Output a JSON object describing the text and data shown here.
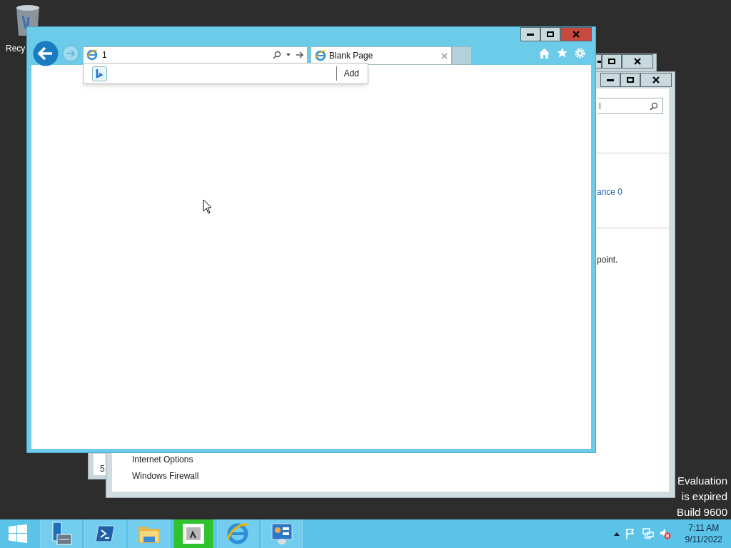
{
  "desktop": {
    "icons": [
      {
        "label": "Recy"
      }
    ],
    "watermark": [
      "Evaluation",
      "is expired",
      "Build 9600"
    ]
  },
  "back_window_1": {
    "fragment": "5"
  },
  "back_window_2": {
    "search_value": "l",
    "link": "ance 0",
    "text": "point.",
    "items": [
      "Internet Options",
      "Windows Firewall"
    ]
  },
  "browser": {
    "address": "1",
    "tabs": [
      {
        "title": "Blank Page",
        "selected": true
      }
    ],
    "suggestion_button": "Add"
  },
  "taskbar": {
    "apps": [
      {
        "kind": "start",
        "active": false
      },
      {
        "kind": "server",
        "active": false
      },
      {
        "kind": "shell",
        "active": false
      },
      {
        "kind": "folder",
        "active": false
      },
      {
        "kind": "app",
        "active": true
      },
      {
        "kind": "browser",
        "active": false
      },
      {
        "kind": "panel",
        "active": false
      }
    ],
    "time": "7:11 AM",
    "date": "9/11/2022"
  }
}
